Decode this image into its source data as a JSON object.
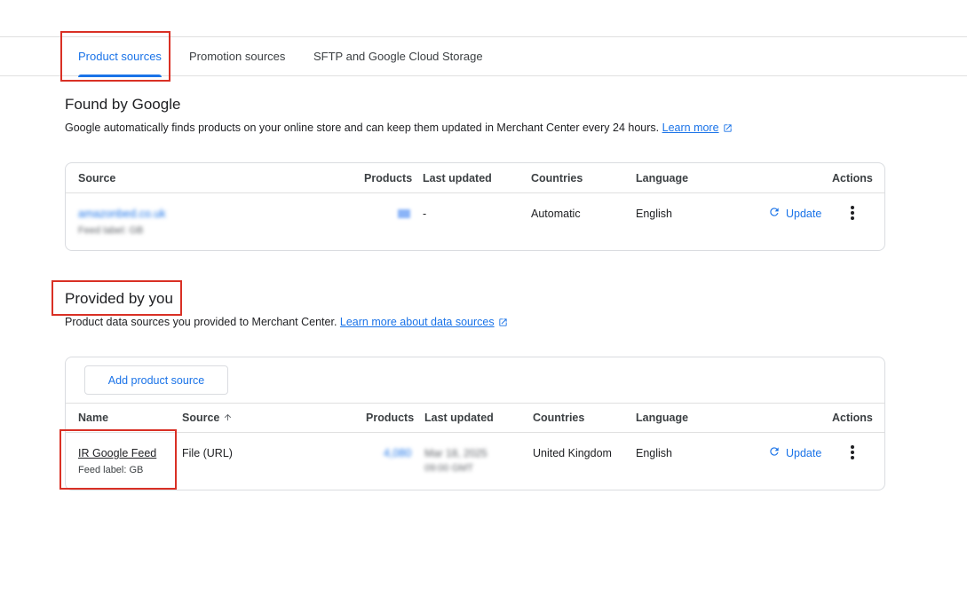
{
  "tabs": [
    {
      "label": "Product sources",
      "active": true
    },
    {
      "label": "Promotion sources",
      "active": false
    },
    {
      "label": "SFTP and Google Cloud Storage",
      "active": false
    }
  ],
  "found_by_google": {
    "title": "Found by Google",
    "description": "Google automatically finds products on your online store and can keep them updated in Merchant Center every 24 hours.",
    "learn_more": "Learn more",
    "columns": {
      "source": "Source",
      "products": "Products",
      "last_updated": "Last updated",
      "countries": "Countries",
      "language": "Language",
      "actions": "Actions"
    },
    "row": {
      "source": "amazonbed.co.uk",
      "feed_label": "Feed label: GB",
      "last_updated": "-",
      "countries": "Automatic",
      "language": "English",
      "update_label": "Update"
    }
  },
  "provided_by_you": {
    "title": "Provided by you",
    "description": "Product data sources you provided to Merchant Center.",
    "learn_more": "Learn more about data sources",
    "add_button": "Add product source",
    "columns": {
      "name": "Name",
      "source": "Source",
      "products": "Products",
      "last_updated": "Last updated",
      "countries": "Countries",
      "language": "Language",
      "actions": "Actions"
    },
    "row": {
      "name": "IR Google Feed",
      "feed_label": "Feed label: GB",
      "source": "File (URL)",
      "products": "4,080",
      "last_updated_date": "Mar 18, 2025",
      "last_updated_time": "09:00 GMT",
      "countries": "United Kingdom",
      "language": "English",
      "update_label": "Update"
    }
  },
  "colors": {
    "accent": "#1a73e8",
    "highlight": "#d93025",
    "border": "#dadce0"
  }
}
